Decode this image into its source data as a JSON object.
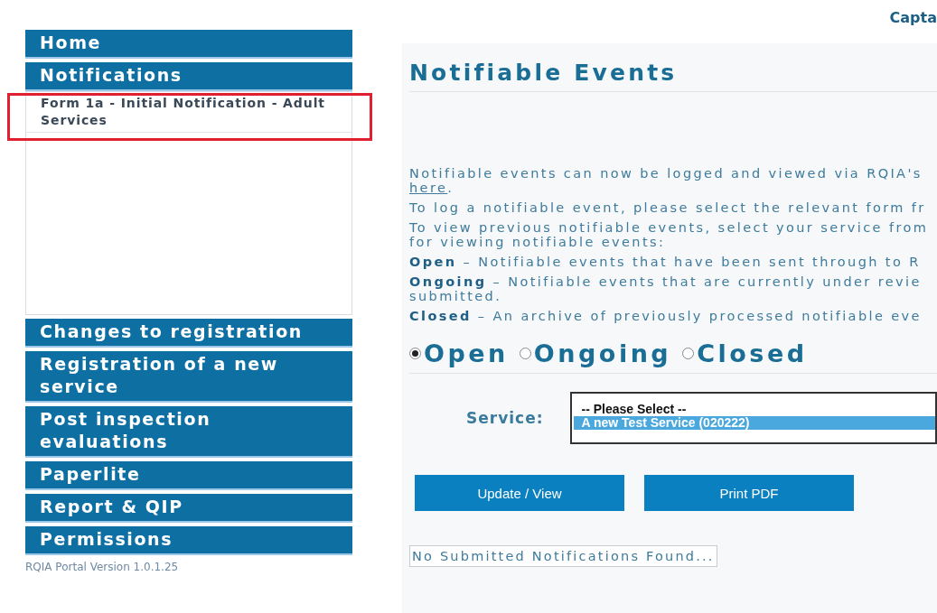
{
  "header": {
    "user": "Capta"
  },
  "sidebar": {
    "items": [
      {
        "label": "Home",
        "expanded": false
      },
      {
        "label": "Notifications",
        "expanded": true,
        "children": [
          {
            "label": "Form 1a - Initial Notification - Adult Services",
            "highlighted": true
          }
        ]
      },
      {
        "label": "Changes to registration",
        "expanded": false
      },
      {
        "label": "Registration of a new service",
        "expanded": false
      },
      {
        "label": "Post inspection evaluations",
        "expanded": false
      },
      {
        "label": "Paperlite",
        "expanded": false
      },
      {
        "label": "Report & QIP",
        "expanded": false
      },
      {
        "label": "Permissions",
        "expanded": false
      }
    ],
    "version": "RQIA Portal Version 1.0.1.25"
  },
  "main": {
    "title": "Notifiable Events",
    "intro": {
      "text": "Notifiable events can now be logged and viewed via RQIA's",
      "link": "here",
      "after": "."
    },
    "paragraphs": [
      "To log a notifiable event, please select the relevant form fr",
      "To view previous notifiable events, select your service from\nfor viewing notifiable events:",
      "**Open** – Notifiable events that have been sent through to R",
      "**Ongoing** – Notifiable events that are currently under revie\nsubmitted.",
      "**Closed** – An archive of previously processed notifiable eve"
    ],
    "filters": [
      {
        "label": "Open",
        "selected": true
      },
      {
        "label": "Ongoing",
        "selected": false
      },
      {
        "label": "Closed",
        "selected": false
      }
    ],
    "service": {
      "label": "Service:",
      "options": [
        {
          "label": "-- Please Select --",
          "selected": false
        },
        {
          "label": "A new Test Service (020222)",
          "selected": true
        }
      ]
    },
    "buttons": [
      "Update / View",
      "Print PDF"
    ],
    "message": "No Submitted Notifications Found..."
  }
}
